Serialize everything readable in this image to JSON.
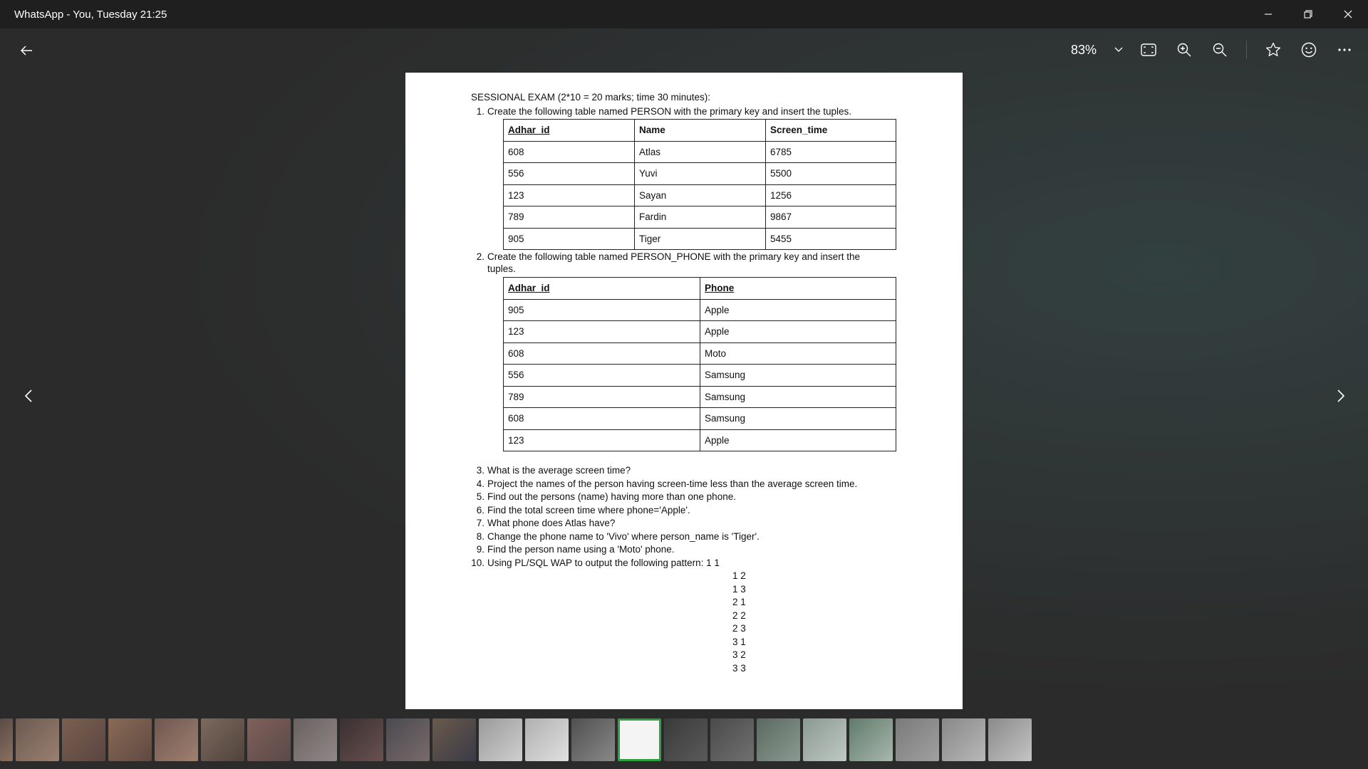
{
  "window": {
    "title": "WhatsApp - You, Tuesday 21:25"
  },
  "toolbar": {
    "zoom": "83%"
  },
  "document": {
    "heading": "SESSIONAL EXAM (2*10 = 20 marks; time 30 minutes):",
    "q1": {
      "num": "1.",
      "text": "Create the following table named PERSON with the primary key and insert the tuples."
    },
    "person_table": {
      "headers": [
        "Adhar_id",
        "Name",
        "Screen_time"
      ],
      "rows": [
        [
          "608",
          "Atlas",
          "6785"
        ],
        [
          "556",
          "Yuvi",
          "5500"
        ],
        [
          "123",
          "Sayan",
          "1256"
        ],
        [
          "789",
          "Fardin",
          "9867"
        ],
        [
          "905",
          "Tiger",
          "5455"
        ]
      ]
    },
    "q2": {
      "num": "2.",
      "line1": "Create the following table named PERSON_PHONE with the primary key and insert the",
      "line2": "tuples."
    },
    "phone_table": {
      "headers": [
        "Adhar_id",
        "Phone"
      ],
      "rows": [
        [
          "905",
          "Apple"
        ],
        [
          "123",
          "Apple"
        ],
        [
          "608",
          "Moto"
        ],
        [
          "556",
          "Samsung"
        ],
        [
          "789",
          "Samsung"
        ],
        [
          "608",
          "Samsung"
        ],
        [
          "123",
          "Apple"
        ]
      ]
    },
    "questions": [
      {
        "num": "3.",
        "text": "What is the average screen time?"
      },
      {
        "num": "4.",
        "text": "Project the names of the person having screen-time less than the average screen time."
      },
      {
        "num": "5.",
        "text": "Find out the persons (name) having more than one phone."
      },
      {
        "num": "6.",
        "text": "Find the total screen time where phone='Apple'."
      },
      {
        "num": "7.",
        "text": "What phone does Atlas have?"
      },
      {
        "num": "8.",
        "text": "Change the phone name to 'Vivo' where person_name is 'Tiger'."
      },
      {
        "num": "9.",
        "text": "Find the person name using a 'Moto' phone."
      },
      {
        "num": "10.",
        "text": "Using PL/SQL WAP to output the following pattern: 1 1"
      }
    ],
    "pattern": [
      "1 2",
      "1 3",
      "2 1",
      "2 2",
      "2 3",
      "3 1",
      "3 2",
      "3 3"
    ]
  },
  "filmstrip": {
    "count": 23,
    "selected_index": 14
  }
}
